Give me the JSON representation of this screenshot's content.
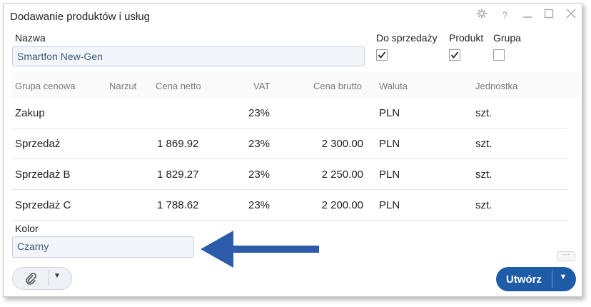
{
  "window": {
    "title": "Dodawanie produktów i usług"
  },
  "form": {
    "name_label": "Nazwa",
    "name_value": "Smartfon New-Gen",
    "for_sale_label": "Do sprzedaży",
    "for_sale_checked": true,
    "product_label": "Produkt",
    "product_checked": true,
    "group_label": "Grupa",
    "group_checked": false,
    "color_label": "Kolor",
    "color_value": "Czarny"
  },
  "table": {
    "columns": [
      "Grupa cenowa",
      "Narzut",
      "Cena netto",
      "VAT",
      "Cena brutto",
      "Waluta",
      "Jednostka"
    ],
    "rows": [
      {
        "group": "Zakup",
        "markup": "",
        "net": "",
        "vat": "23%",
        "gross": "",
        "currency": "PLN",
        "unit": "szt."
      },
      {
        "group": "Sprzedaż",
        "markup": "",
        "net": "1 869.92",
        "vat": "23%",
        "gross": "2 300.00",
        "currency": "PLN",
        "unit": "szt."
      },
      {
        "group": "Sprzedaż B",
        "markup": "",
        "net": "1 829.27",
        "vat": "23%",
        "gross": "2 250.00",
        "currency": "PLN",
        "unit": "szt."
      },
      {
        "group": "Sprzedaż C",
        "markup": "",
        "net": "1 788.62",
        "vat": "23%",
        "gross": "2 200.00",
        "currency": "PLN",
        "unit": "szt."
      }
    ]
  },
  "footer": {
    "create_label": "Utwórz",
    "more_label": "···"
  },
  "icons": {
    "settings": "gear-icon",
    "help": "question-icon",
    "minimize": "minimize-icon",
    "maximize": "maximize-icon",
    "close": "close-icon",
    "attach": "paperclip-icon",
    "annotation": "arrow-left-icon"
  },
  "colors": {
    "accent": "#1f5ca7",
    "arrow": "#2c5ca9",
    "input_text": "#3d5a78"
  }
}
